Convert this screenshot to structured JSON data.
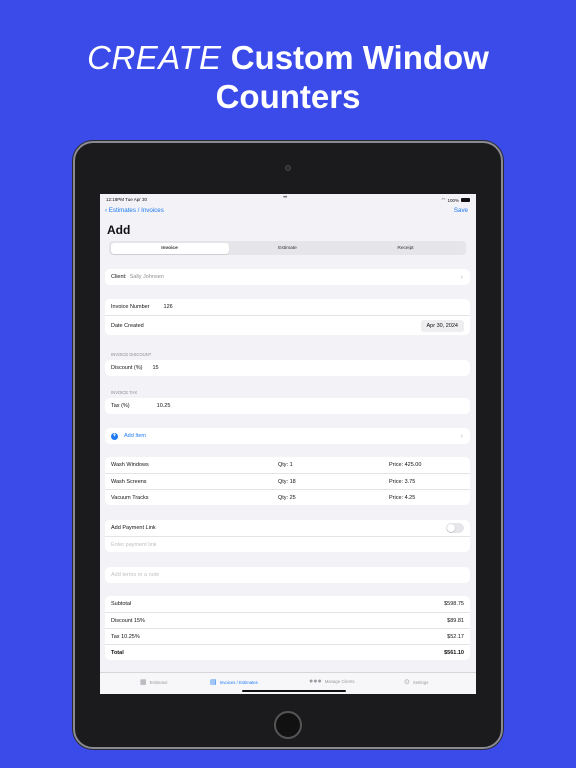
{
  "headline": {
    "italic": "CREATE",
    "line1_rest": "Custom Window",
    "line2": "Counters"
  },
  "statusbar": {
    "time": "12:18PM  Tue Apr 30",
    "dots": "•••",
    "battery": "100%"
  },
  "nav": {
    "back": "‹ Estimates / Invoices",
    "save": "Save"
  },
  "page_title": "Add",
  "segments": [
    "Invoice",
    "Estimate",
    "Receipt"
  ],
  "client": {
    "label": "Client:",
    "value": "Sally Johnsen"
  },
  "invoice": {
    "number_label": "Invoice Number",
    "number_value": "126",
    "date_label": "Date Created",
    "date_value": "Apr 30, 2024"
  },
  "discount": {
    "section": "INVOICE DISCOUNT",
    "label": "Discount (%)",
    "value": "15"
  },
  "tax": {
    "section": "INVOICE TAX",
    "label": "Tax (%)",
    "value": "10.25"
  },
  "add_item": {
    "icon": "+",
    "label": "Add Item"
  },
  "items": [
    {
      "name": "Wash Windows",
      "qty": "Qty: 1",
      "price": "Price: 425.00"
    },
    {
      "name": "Wash Screens",
      "qty": "Qty: 18",
      "price": "Price: 3.75"
    },
    {
      "name": "Vacuum Tracks",
      "qty": "Qty: 25",
      "price": "Price: 4.25"
    }
  ],
  "payment": {
    "label": "Add Payment Link",
    "placeholder": "Enter payment link",
    "enabled": false
  },
  "notes_placeholder": "Add terms or a note",
  "summary": [
    {
      "label": "Subtotal",
      "value": "$598.75"
    },
    {
      "label": "Discount 15%",
      "value": "$89.81"
    },
    {
      "label": "Tax 10.25%",
      "value": "$52.17"
    },
    {
      "label": "Total",
      "value": "$561.10"
    }
  ],
  "tabs": [
    {
      "icon": "calculator-icon",
      "label": "Estimator"
    },
    {
      "icon": "document-icon",
      "label": "Invoices / Estimates"
    },
    {
      "icon": "people-icon",
      "label": "Manage Clients"
    },
    {
      "icon": "gear-icon",
      "label": "Settings"
    }
  ],
  "colors": {
    "background": "#3b4bea",
    "accent": "#1d7af3"
  }
}
